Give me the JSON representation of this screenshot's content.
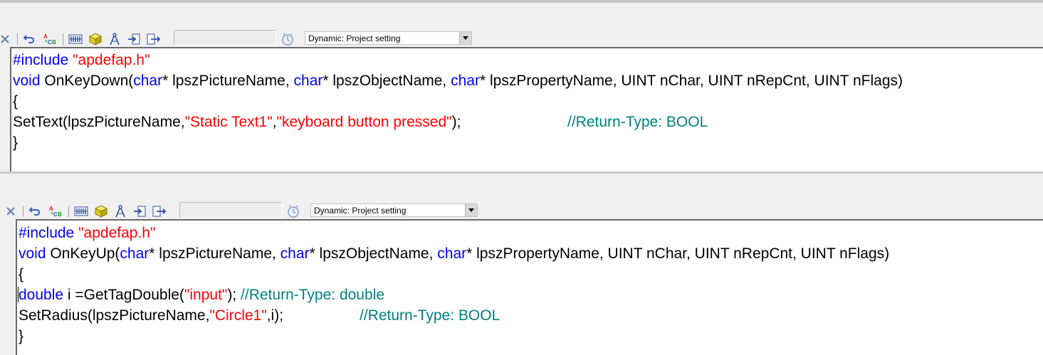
{
  "panes": [
    {
      "toolbar": {
        "icons": [
          "close-icon",
          "undo-icon",
          "spell-check-icon",
          "tags-icon",
          "object-icon",
          "compass-icon",
          "import-icon",
          "export-icon",
          "trigger-clock-icon"
        ],
        "trigger_dropdown": {
          "value": "Dynamic: Project setting"
        }
      },
      "code": {
        "include_kw": "#include",
        "include_file": "\"apdefap.h\"",
        "void_kw": "void",
        "func_name": " OnKeyDown(",
        "char1": "char",
        "arg1": "* lpszPictureName, ",
        "char2": "char",
        "arg2": "* lpszObjectName, ",
        "char3": "char",
        "arg3": "* lpszPropertyName, UINT nChar, UINT nRepCnt, UINT nFlags)",
        "open_brace": "{",
        "settext_call": "SetText(lpszPictureName,",
        "settext_arg1": "\"Static Text1\"",
        "comma": ",",
        "settext_arg2": "\"keyboard button pressed\"",
        "settext_end": ");",
        "settext_comment": "//Return-Type: BOOL",
        "close_brace": "}"
      }
    },
    {
      "toolbar": {
        "icons": [
          "close-icon",
          "undo-icon",
          "spell-check-icon",
          "tags-icon",
          "object-icon",
          "compass-icon",
          "import-icon",
          "export-icon",
          "trigger-clock-icon"
        ],
        "trigger_dropdown": {
          "value": "Dynamic: Project setting"
        }
      },
      "code": {
        "include_kw": "#include",
        "include_file": "\"apdefap.h\"",
        "void_kw": "void",
        "func_name": " OnKeyUp(",
        "char1": "char",
        "arg1": "* lpszPictureName, ",
        "char2": "char",
        "arg2": "* lpszObjectName, ",
        "char3": "char",
        "arg3": "* lpszPropertyName, UINT nChar, UINT nRepCnt, UINT nFlags)",
        "open_brace": "{",
        "double_kw": "double",
        "double_rest": " i =GetTagDouble(",
        "double_arg": "\"input\"",
        "double_end": ");",
        "double_comment": "//Return-Type: double",
        "setradius_call": "SetRadius(lpszPictureName,",
        "setradius_arg": "\"Circle1\"",
        "setradius_end": ",i);",
        "setradius_comment": "//Return-Type: BOOL",
        "close_brace": "}"
      }
    }
  ]
}
